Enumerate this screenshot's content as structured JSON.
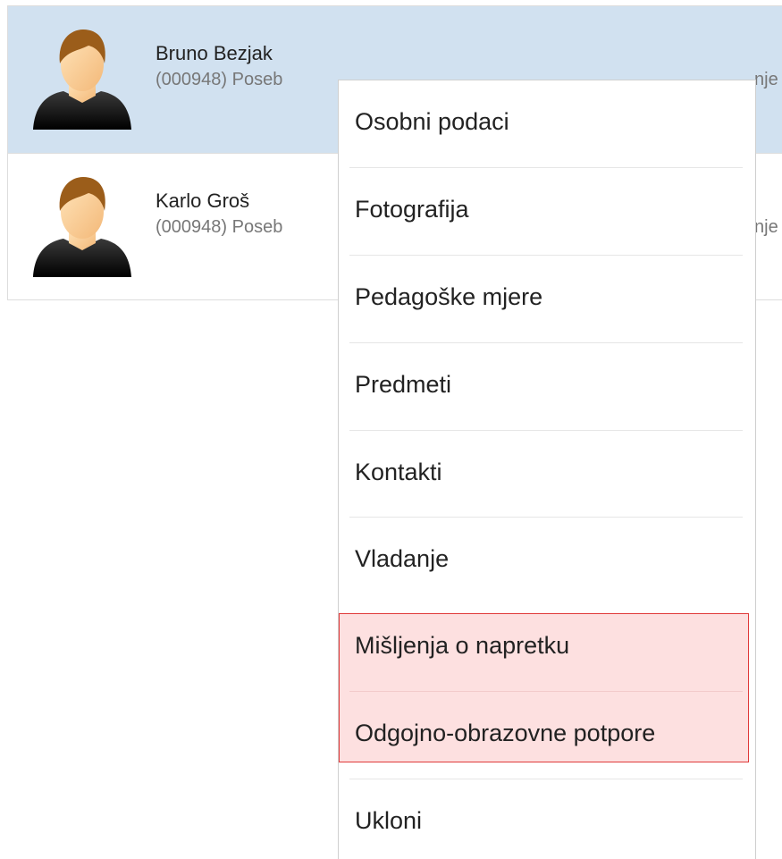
{
  "students": [
    {
      "name": "Bruno Bezjak",
      "subtitle": "(000948) Poseb",
      "subtitle_tail": "nje",
      "selected": true
    },
    {
      "name": "Karlo Groš",
      "subtitle": "(000948) Poseb",
      "subtitle_tail": "nje",
      "selected": false
    }
  ],
  "context_menu": {
    "items": [
      {
        "label": "Osobni podaci",
        "highlighted": false
      },
      {
        "label": "Fotografija",
        "highlighted": false
      },
      {
        "label": "Pedagoške mjere",
        "highlighted": false
      },
      {
        "label": "Predmeti",
        "highlighted": false
      },
      {
        "label": "Kontakti",
        "highlighted": false
      },
      {
        "label": "Vladanje",
        "highlighted": false
      },
      {
        "label": "Mišljenja o napretku",
        "highlighted": true
      },
      {
        "label": "Odgojno-obrazovne potpore",
        "highlighted": true
      },
      {
        "label": "Ukloni",
        "highlighted": false
      }
    ]
  },
  "colors": {
    "selected_row_bg": "#d1e1f0",
    "highlight_fill": "#fde0e0",
    "highlight_border": "#e03a3a",
    "text_primary": "#222222",
    "text_secondary": "#777777"
  },
  "icons": {
    "avatar": "user-avatar-icon"
  }
}
